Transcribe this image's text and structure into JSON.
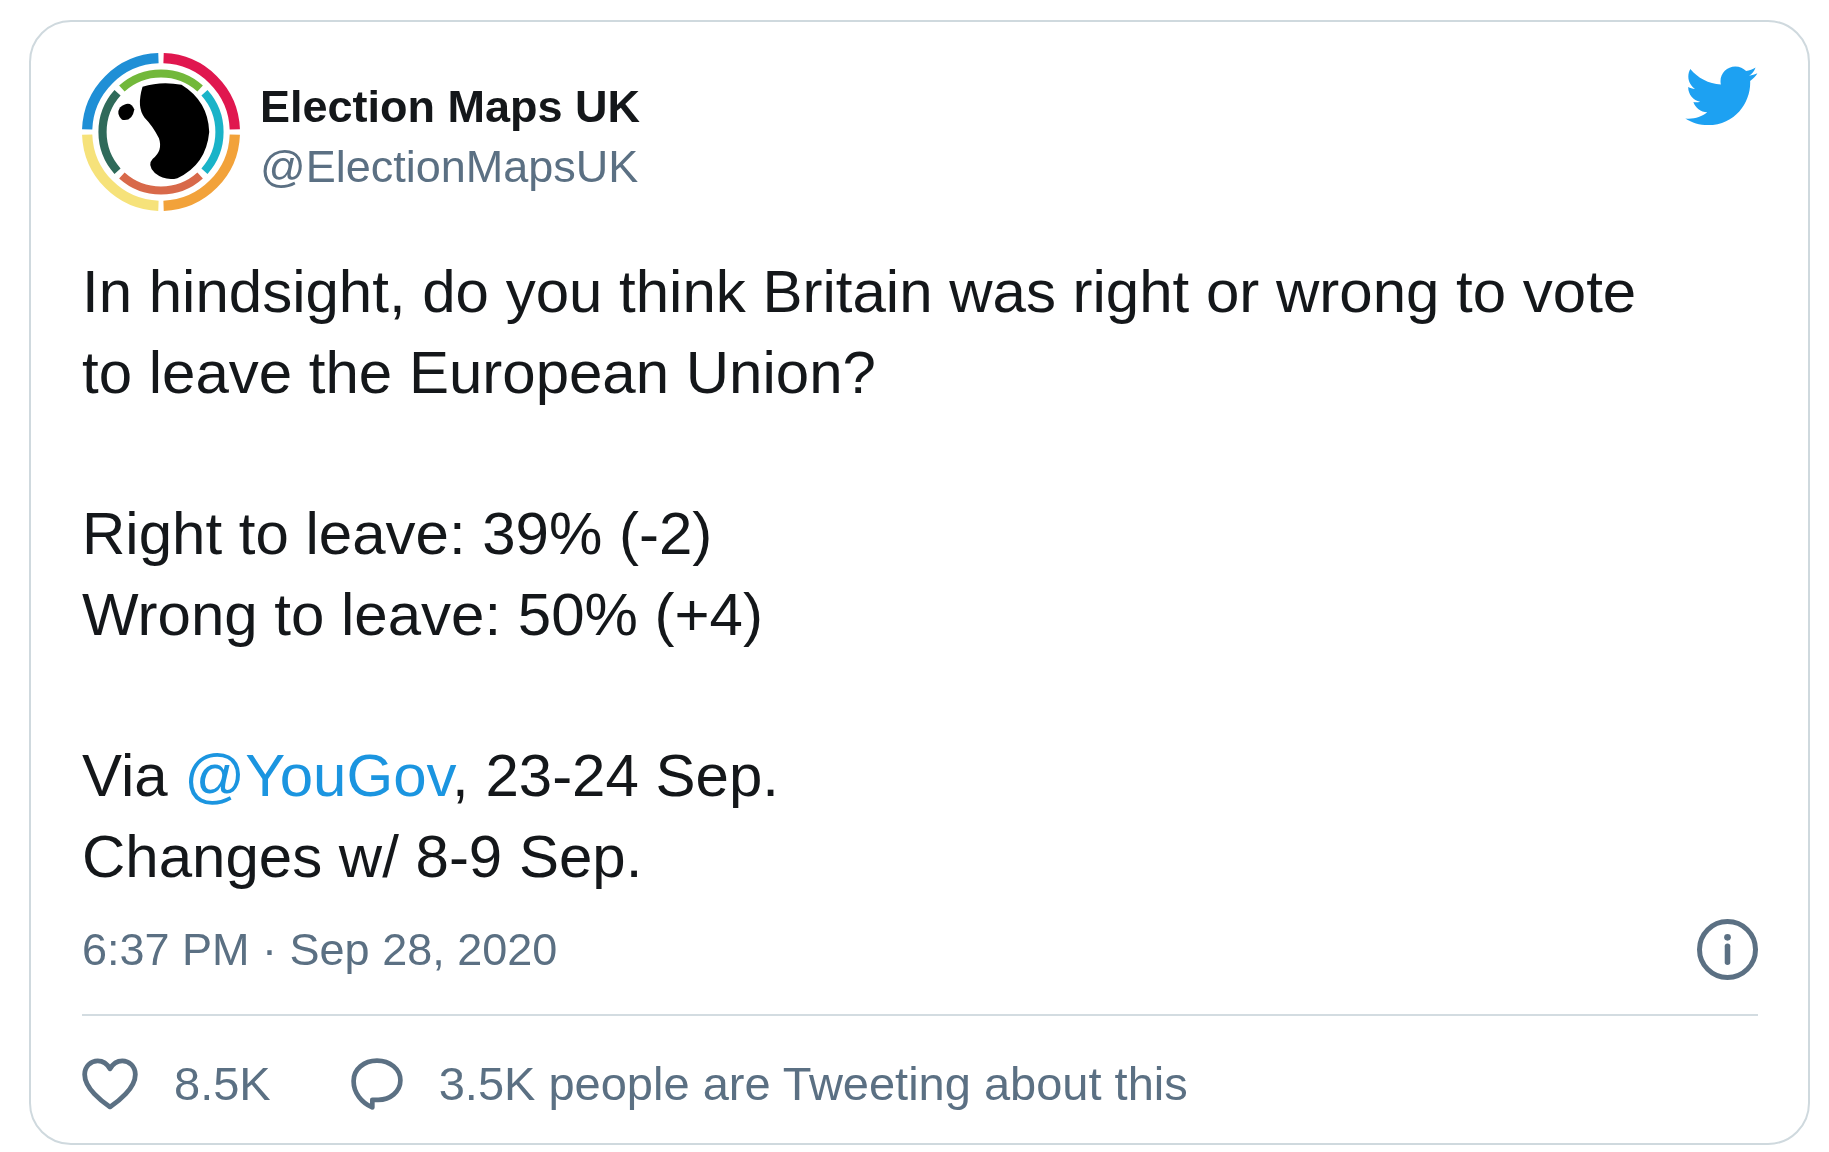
{
  "tweet": {
    "author": {
      "name": "Election Maps UK",
      "handle": "@ElectionMapsUK"
    },
    "paragraphs": [
      {
        "lines": [
          {
            "segments": [
              {
                "kind": "text",
                "text": "In hindsight, do you think Britain was right or wrong to vote to leave the European Union?"
              }
            ]
          }
        ]
      },
      {
        "lines": [
          {
            "segments": [
              {
                "kind": "text",
                "text": "Right to leave: 39% (-2)"
              }
            ]
          },
          {
            "segments": [
              {
                "kind": "text",
                "text": "Wrong to leave: 50% (+4)"
              }
            ]
          }
        ]
      },
      {
        "lines": [
          {
            "segments": [
              {
                "kind": "text",
                "text": "Via "
              },
              {
                "kind": "mention",
                "text": "@YouGov"
              },
              {
                "kind": "text",
                "text": ", 23-24 Sep."
              }
            ]
          },
          {
            "segments": [
              {
                "kind": "text",
                "text": "Changes w/ 8-9 Sep."
              }
            ]
          }
        ]
      }
    ],
    "timestamp": "6:37 PM · Sep 28, 2020",
    "stats": [
      {
        "kind": "likes",
        "text": "8.5K"
      },
      {
        "kind": "conversation",
        "text": "3.5K people are Tweeting about this"
      }
    ]
  }
}
